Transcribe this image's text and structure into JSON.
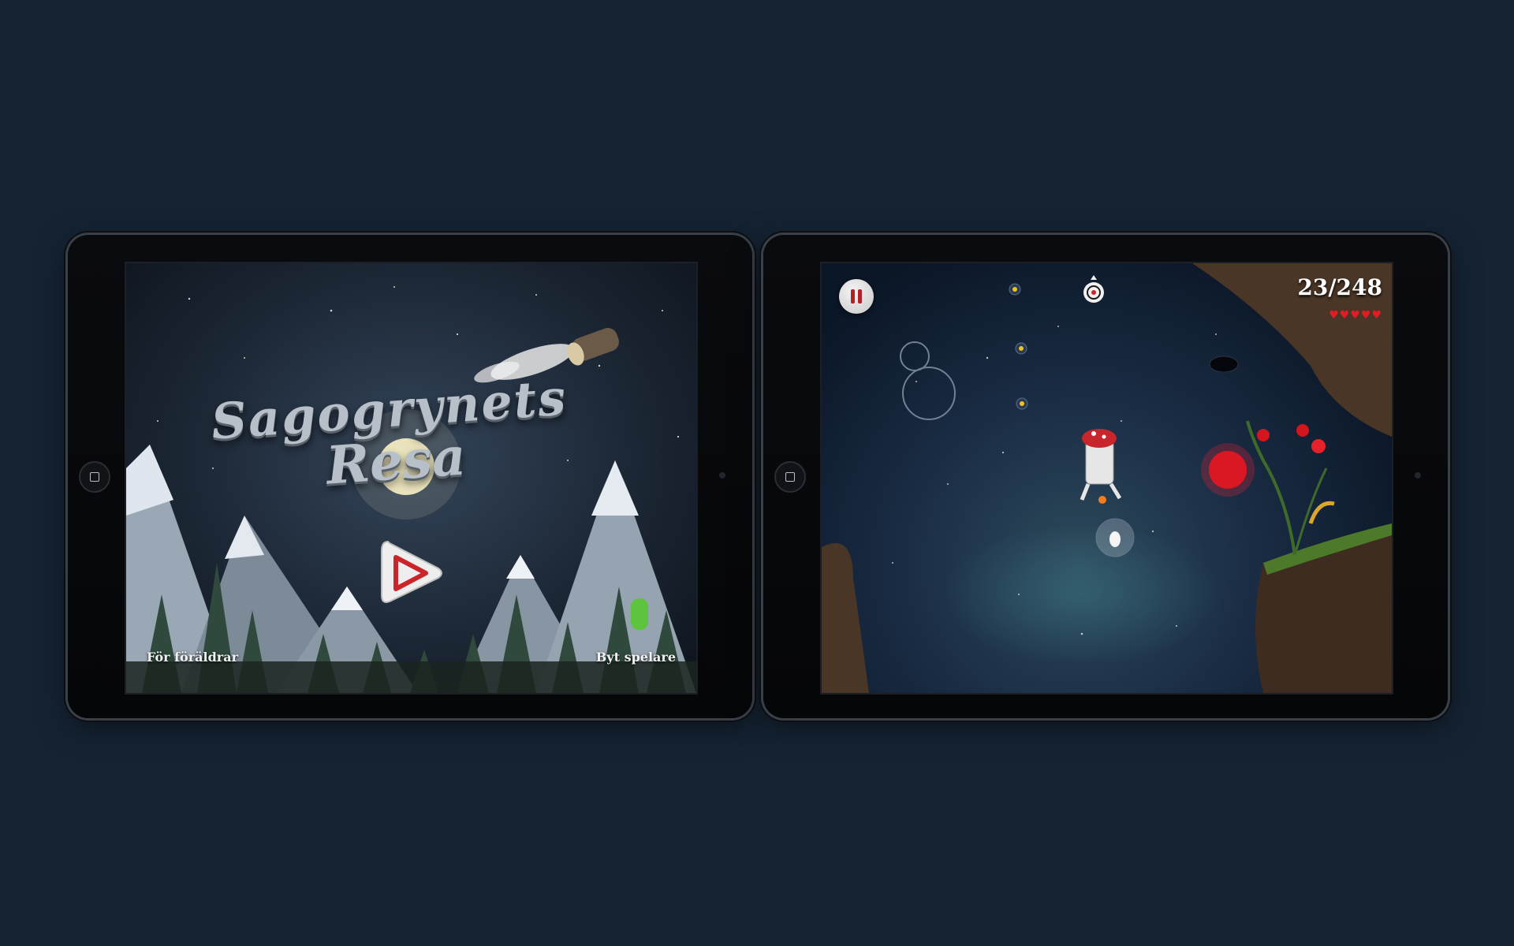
{
  "menu_screen": {
    "title_line1": "Sagogrynets",
    "title_line2": "Resa",
    "play_button": "play-icon",
    "parents_link": "För föräldrar",
    "switch_player_link": "Byt spelare"
  },
  "game_screen": {
    "pause_button": "pause-icon",
    "score": "23/248",
    "hearts": "♥♥♥♥♥",
    "lives": 5
  },
  "colors": {
    "background": "#152333",
    "heart": "#e01d25",
    "pause_icon": "#b22225"
  }
}
